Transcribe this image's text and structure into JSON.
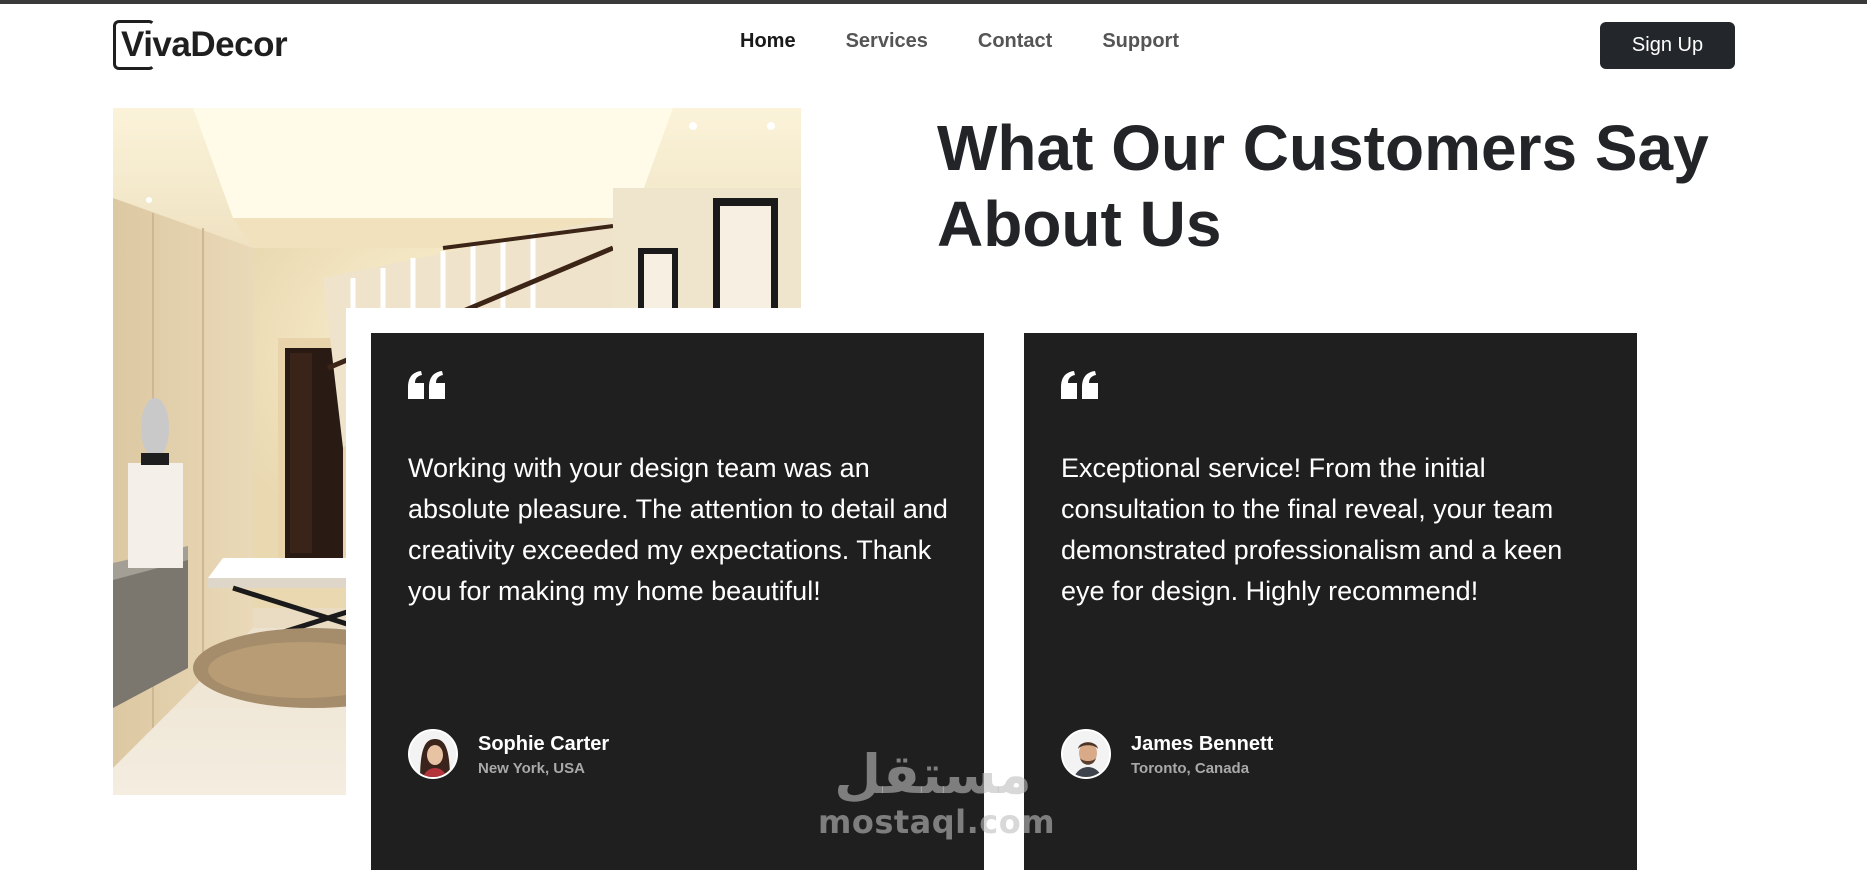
{
  "header": {
    "logo_text": "VivaDecor",
    "nav": [
      {
        "label": "Home",
        "active": true
      },
      {
        "label": "Services",
        "active": false
      },
      {
        "label": "Contact",
        "active": false
      },
      {
        "label": "Support",
        "active": false
      }
    ],
    "signup_label": "Sign Up"
  },
  "section": {
    "heading_line1": "What Our Customers Say",
    "heading_line2": "About Us"
  },
  "testimonials": [
    {
      "quote": "Working with your design team was an absolute pleasure. The attention to detail and creativity exceeded my expectations. Thank you for making my home beautiful!",
      "name": "Sophie Carter",
      "location": "New York, USA"
    },
    {
      "quote": "Exceptional service! From the initial consultation to the final reveal, your team demonstrated professionalism and a keen eye for design. Highly recommend!",
      "name": "James Bennett",
      "location": "Toronto, Canada"
    }
  ],
  "watermark": {
    "arabic": "مستقل",
    "latin": "mostaql.com"
  },
  "icons": {
    "quote": "quote-open-icon",
    "logo_frame": "logo-frame-icon"
  },
  "colors": {
    "card_bg": "#1f1f1f",
    "button_bg": "#23272b",
    "heading": "#222428",
    "nav_active": "#1a1a1a",
    "nav_inactive": "#555555"
  }
}
